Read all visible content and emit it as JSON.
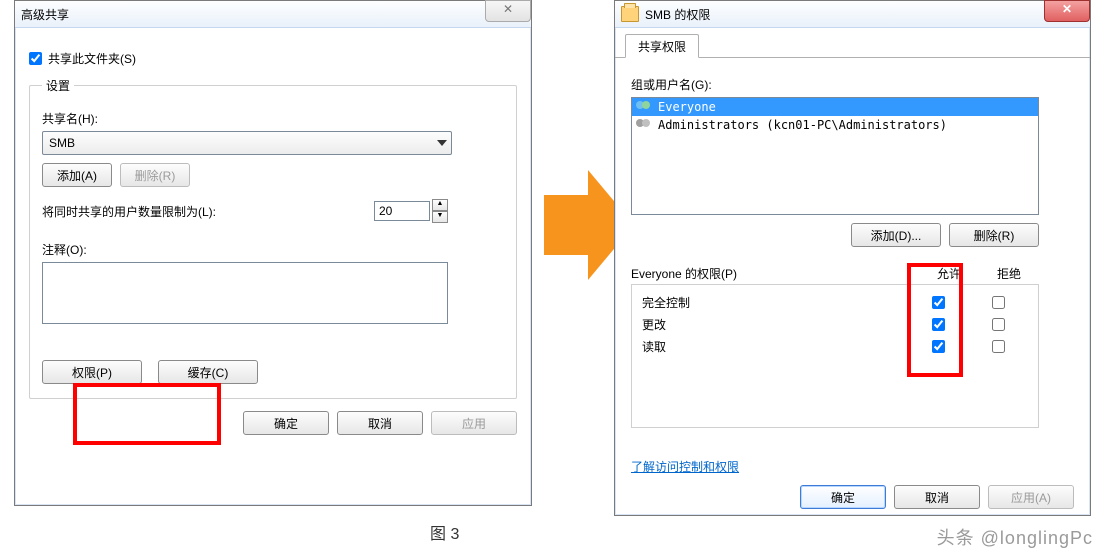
{
  "left": {
    "title": "高级共享",
    "share_checkbox_label": "共享此文件夹(S)",
    "share_checked": true,
    "settings_legend": "设置",
    "share_name_label": "共享名(H):",
    "share_name_value": "SMB",
    "add_btn": "添加(A)",
    "remove_btn": "删除(R)",
    "limit_label": "将同时共享的用户数量限制为(L):",
    "limit_value": "20",
    "comment_label": "注释(O):",
    "comment_value": "",
    "perm_btn": "权限(P)",
    "cache_btn": "缓存(C)",
    "ok": "确定",
    "cancel": "取消",
    "apply": "应用"
  },
  "right": {
    "title": "SMB 的权限",
    "tab_label": "共享权限",
    "group_label": "组或用户名(G):",
    "list": {
      "row1": "Everyone",
      "row2": "Administrators (kcn01-PC\\Administrators)"
    },
    "add_btn": "添加(D)...",
    "remove_btn": "删除(R)",
    "perm_for_label": "Everyone 的权限(P)",
    "col_allow": "允许",
    "col_deny": "拒绝",
    "perms": {
      "full": "完全控制",
      "change": "更改",
      "read": "读取"
    },
    "link": "了解访问控制和权限",
    "ok": "确定",
    "cancel": "取消",
    "apply": "应用(A)"
  },
  "figure_caption": "图 3",
  "watermark": "头条 @longlingPc"
}
